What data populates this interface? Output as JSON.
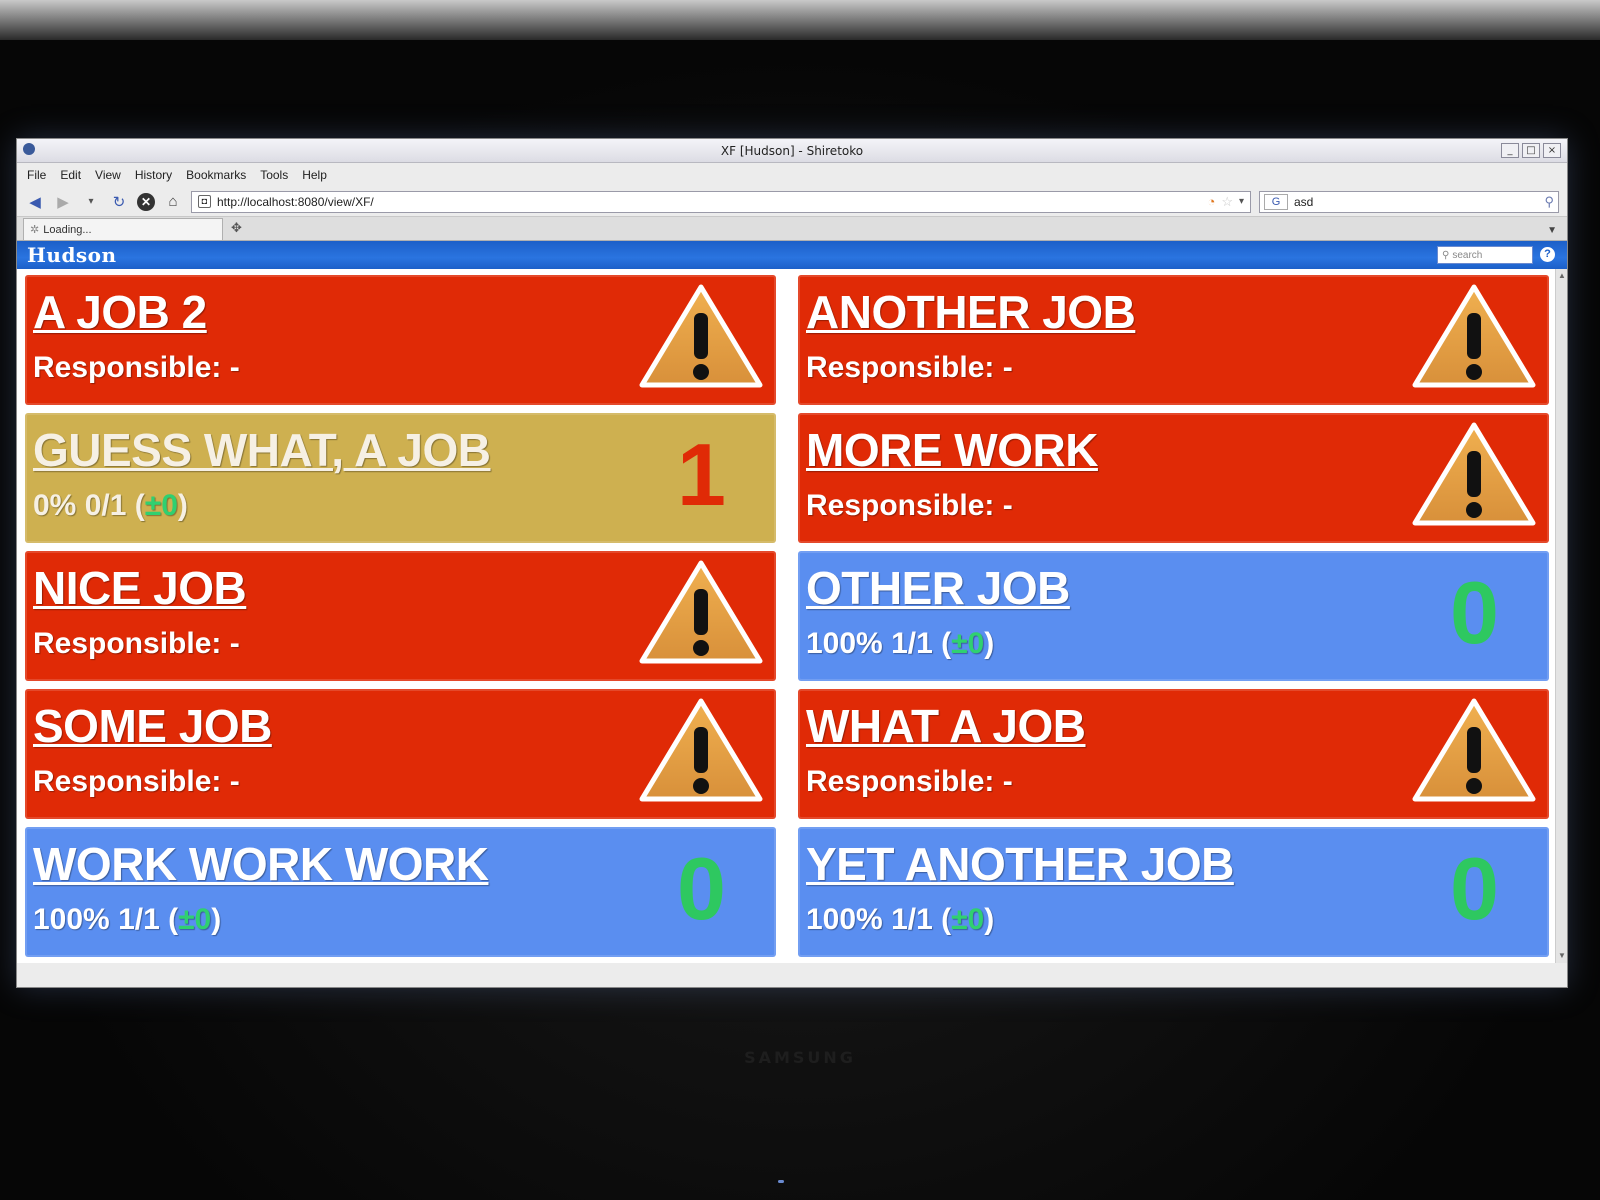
{
  "window": {
    "title": "XF [Hudson] - Shiretoko",
    "buttons": {
      "minimize": "_",
      "maximize": "□",
      "close": "×"
    }
  },
  "menu": [
    "File",
    "Edit",
    "View",
    "History",
    "Bookmarks",
    "Tools",
    "Help"
  ],
  "navbar": {
    "url": "http://localhost:8080/view/XF/",
    "search_value": "asd",
    "search_engine": "G"
  },
  "tabs": [
    {
      "label": "Loading..."
    }
  ],
  "hudson": {
    "logo": "Hudson",
    "search_placeholder": "search",
    "help": "?"
  },
  "colors": {
    "failed": "#e02a06",
    "unstable": "#ceb050",
    "success": "#5a8ef0",
    "delta_green": "#30d070",
    "header_blue": "#1c5fc8"
  },
  "jobs": [
    {
      "name": "A JOB 2",
      "status": "failed",
      "info": "Responsible: -"
    },
    {
      "name": "ANOTHER JOB",
      "status": "failed",
      "info": "Responsible: -"
    },
    {
      "name": "GUESS WHAT, A JOB",
      "status": "unstable",
      "count": "1",
      "info_prefix": "0% 0/1 (",
      "delta": "±0",
      "info_suffix": ")"
    },
    {
      "name": "MORE WORK",
      "status": "failed",
      "info": "Responsible: -"
    },
    {
      "name": "NICE JOB",
      "status": "failed",
      "info": "Responsible: -"
    },
    {
      "name": "OTHER JOB",
      "status": "success",
      "count": "0",
      "info_prefix": "100% 1/1 (",
      "delta": "±0",
      "info_suffix": ")"
    },
    {
      "name": "SOME JOB",
      "status": "failed",
      "info": "Responsible: -"
    },
    {
      "name": "WHAT A JOB",
      "status": "failed",
      "info": "Responsible: -"
    },
    {
      "name": "WORK WORK WORK",
      "status": "success",
      "count": "0",
      "info_prefix": "100% 1/1 (",
      "delta": "±0",
      "info_suffix": ")"
    },
    {
      "name": "YET ANOTHER JOB",
      "status": "success",
      "count": "0",
      "info_prefix": "100% 1/1 (",
      "delta": "±0",
      "info_suffix": ")"
    }
  ]
}
